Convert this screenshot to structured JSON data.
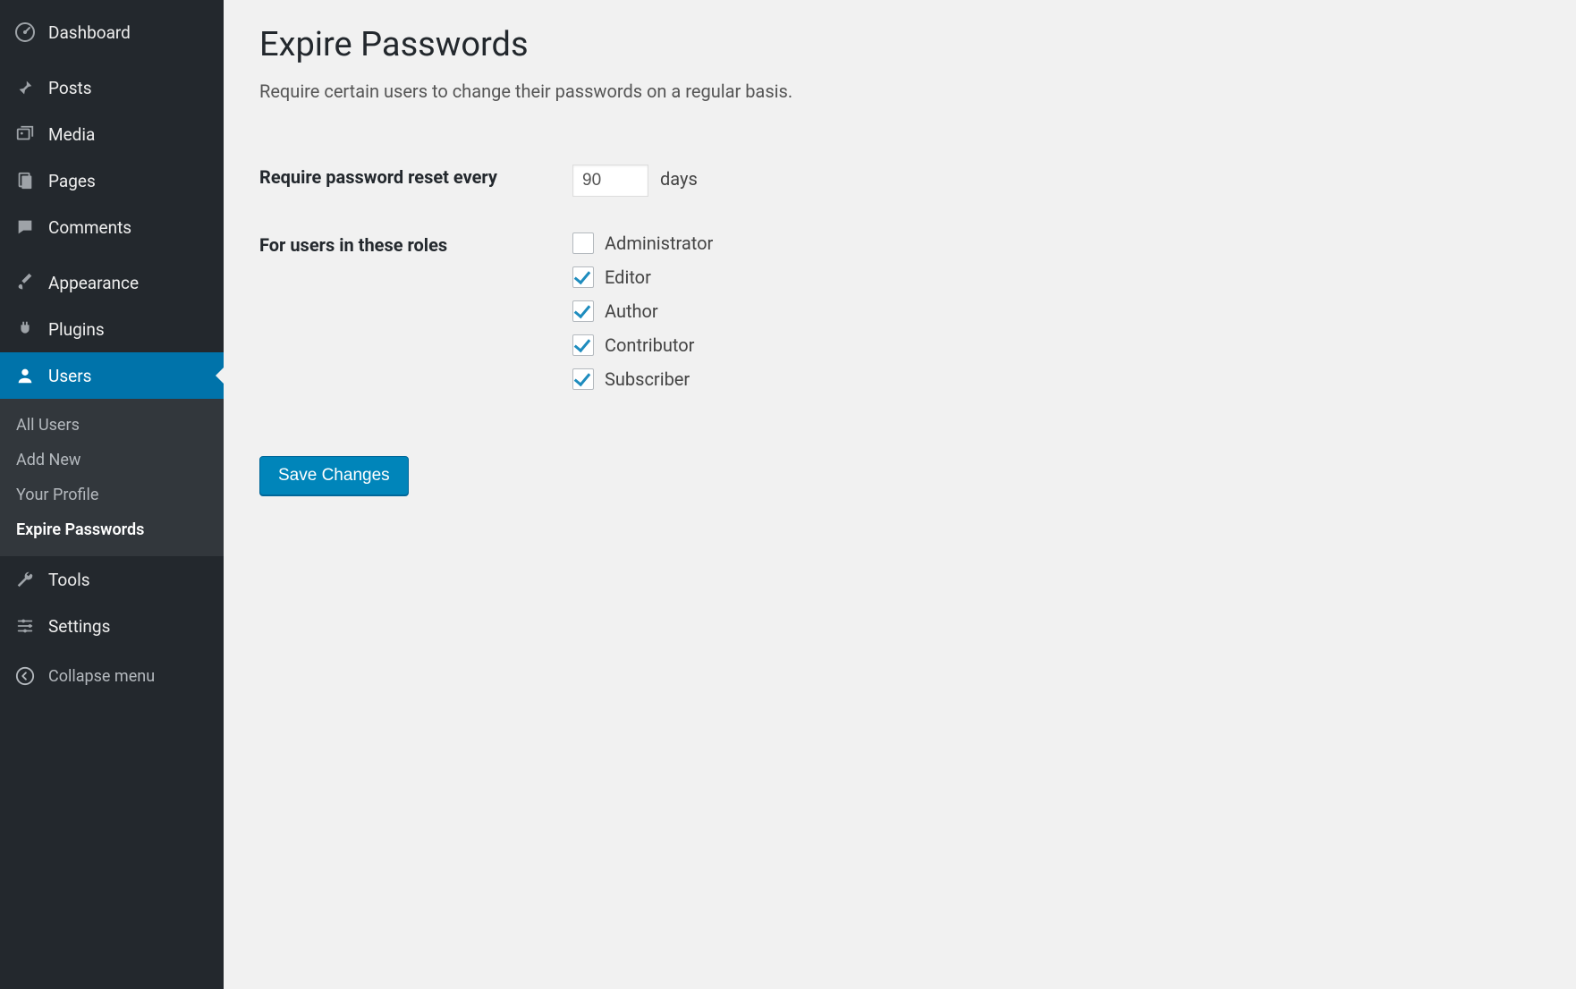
{
  "sidebar": {
    "items": [
      {
        "label": "Dashboard",
        "icon": "dashboard"
      },
      {
        "label": "Posts",
        "icon": "pin"
      },
      {
        "label": "Media",
        "icon": "media"
      },
      {
        "label": "Pages",
        "icon": "pages"
      },
      {
        "label": "Comments",
        "icon": "comment"
      },
      {
        "label": "Appearance",
        "icon": "brush"
      },
      {
        "label": "Plugins",
        "icon": "plug"
      },
      {
        "label": "Users",
        "icon": "user",
        "active": true
      },
      {
        "label": "Tools",
        "icon": "wrench"
      },
      {
        "label": "Settings",
        "icon": "sliders"
      }
    ],
    "submenu": [
      {
        "label": "All Users"
      },
      {
        "label": "Add New"
      },
      {
        "label": "Your Profile"
      },
      {
        "label": "Expire Passwords",
        "current": true
      }
    ],
    "collapse_label": "Collapse menu"
  },
  "page": {
    "title": "Expire Passwords",
    "description": "Require certain users to change their passwords on a regular basis.",
    "reset_label": "Require password reset every",
    "reset_value": "90",
    "reset_unit": "days",
    "roles_label": "For users in these roles",
    "roles": [
      {
        "name": "Administrator",
        "checked": false
      },
      {
        "name": "Editor",
        "checked": true
      },
      {
        "name": "Author",
        "checked": true
      },
      {
        "name": "Contributor",
        "checked": true
      },
      {
        "name": "Subscriber",
        "checked": true
      }
    ],
    "save_label": "Save Changes"
  }
}
